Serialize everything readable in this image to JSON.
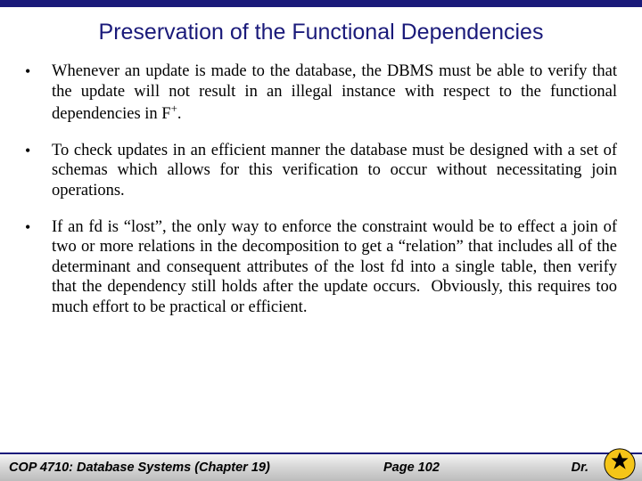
{
  "title": "Preservation of the Functional Dependencies",
  "bullets": [
    {
      "text_html": "Whenever an update is made to the database, the DBMS must be able to verify that the update will not result in an illegal instance with respect to the functional dependencies in F<sup>+</sup>."
    },
    {
      "text_html": "To check updates in an efficient manner the database must be designed with a set of schemas which allows for this verification to occur without necessitating join operations."
    },
    {
      "text_html": "If an fd is “lost”, the only way to enforce the constraint would be to effect a join of two or more relations in the decomposition to get a “relation” that includes all of the determinant and consequent attributes of the lost fd into a single table, then verify that the dependency still holds after the update occurs.&nbsp;&nbsp;Obviously, this requires too much effort to be practical or efficient."
    }
  ],
  "footer": {
    "course": "COP 4710: Database Systems  (Chapter 19)",
    "page": "Page 102",
    "author": "Dr."
  }
}
